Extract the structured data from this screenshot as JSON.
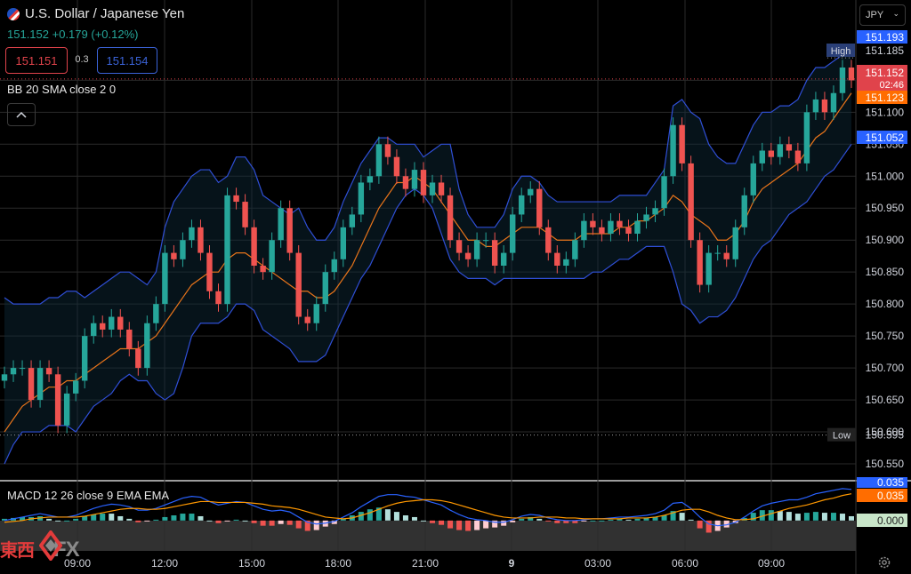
{
  "header": {
    "title": "U.S. Dollar / Japanese Yen",
    "price": "151.152",
    "change": "+0.179 (+0.12%)",
    "sell": "151.151",
    "spread": "0.3",
    "buy": "151.154",
    "currency": "JPY",
    "bb_label": "BB 20 SMA close 2 0",
    "macd_label": "MACD 12 26 close 9 EMA EMA"
  },
  "logo": {
    "text": "東西",
    "fx": "FX"
  },
  "colors": {
    "up": "#26a69a",
    "down": "#ef5350",
    "bb": "#2f4fd6",
    "basis": "#e8741a",
    "macd": "#2962ff",
    "signal": "#ff9800",
    "high_tag": "#2a3f77",
    "price_tag": "#e0434b"
  },
  "chart_data": [
    {
      "type": "candlestick",
      "title": "U.S. Dollar / Japanese Yen",
      "indicator": "BB 20 SMA close 2 0",
      "x_ticks": [
        "09:00",
        "12:00",
        "15:00",
        "18:00",
        "21:00",
        "9",
        "03:00",
        "06:00",
        "09:00"
      ],
      "y_ticks": [
        151.15,
        151.1,
        151.05,
        151.0,
        150.95,
        150.9,
        150.85,
        150.8,
        150.75,
        150.7,
        150.65,
        150.6,
        150.55
      ],
      "ylim": [
        150.525,
        151.22
      ],
      "grid": true,
      "series": [
        {
          "name": "close",
          "values": [
            150.69,
            150.7,
            150.7,
            150.65,
            150.7,
            150.69,
            150.61,
            150.66,
            150.68,
            150.75,
            150.77,
            150.76,
            150.78,
            150.76,
            150.73,
            150.7,
            150.77,
            150.8,
            150.88,
            150.87,
            150.9,
            150.92,
            150.88,
            150.82,
            150.8,
            150.97,
            150.96,
            150.92,
            150.86,
            150.85,
            150.9,
            150.95,
            150.88,
            150.78,
            150.77,
            150.8,
            150.85,
            150.87,
            150.92,
            150.94,
            150.99,
            151.0,
            151.05,
            151.03,
            151.0,
            150.98,
            151.01,
            150.97,
            150.99,
            150.97,
            150.9,
            150.88,
            150.87,
            150.9,
            150.9,
            150.86,
            150.88,
            150.94,
            150.97,
            150.98,
            150.92,
            150.88,
            150.86,
            150.87,
            150.9,
            150.93,
            150.92,
            150.91,
            150.93,
            150.92,
            150.91,
            150.93,
            150.94,
            150.95,
            151.0,
            151.08,
            151.02,
            150.9,
            150.83,
            150.88,
            150.88,
            150.87,
            150.92,
            150.97,
            151.02,
            151.04,
            151.03,
            151.05,
            151.04,
            151.02,
            151.1,
            151.12,
            151.1,
            151.13,
            151.17,
            151.15
          ]
        },
        {
          "name": "BB upper",
          "values": [
            150.81,
            150.8,
            150.8,
            150.8,
            150.8,
            150.81,
            150.81,
            150.82,
            150.82,
            150.81,
            150.82,
            150.83,
            150.84,
            150.85,
            150.85,
            150.84,
            150.83,
            150.85,
            150.92,
            150.96,
            150.98,
            151.0,
            151.01,
            151.01,
            150.99,
            151.0,
            151.03,
            151.03,
            151.01,
            150.97,
            150.96,
            150.95,
            150.94,
            150.95,
            150.92,
            150.9,
            150.9,
            150.92,
            150.96,
            150.99,
            151.02,
            151.04,
            151.06,
            151.06,
            151.05,
            151.05,
            151.05,
            151.03,
            151.04,
            151.05,
            151.05,
            150.98,
            150.94,
            150.92,
            150.92,
            150.92,
            150.94,
            150.98,
            151.0,
            151.0,
            150.99,
            150.97,
            150.96,
            150.96,
            150.96,
            150.96,
            150.96,
            150.96,
            150.96,
            150.97,
            150.97,
            150.97,
            150.97,
            150.99,
            151.01,
            151.11,
            151.12,
            151.1,
            151.09,
            151.05,
            151.03,
            151.02,
            151.02,
            151.05,
            151.08,
            151.1,
            151.1,
            151.11,
            151.11,
            151.12,
            151.15,
            151.17,
            151.17,
            151.18,
            151.19,
            151.2
          ]
        },
        {
          "name": "BB basis",
          "values": [
            150.6,
            150.62,
            150.64,
            150.65,
            150.66,
            150.67,
            150.67,
            150.68,
            150.68,
            150.69,
            150.7,
            150.71,
            150.72,
            150.73,
            150.73,
            150.73,
            150.74,
            150.75,
            150.77,
            150.79,
            150.81,
            150.83,
            150.84,
            150.85,
            150.85,
            150.87,
            150.88,
            150.88,
            150.87,
            150.86,
            150.85,
            150.84,
            150.83,
            150.82,
            150.82,
            150.81,
            150.81,
            150.82,
            150.84,
            150.86,
            150.89,
            150.92,
            150.95,
            150.97,
            150.99,
            150.99,
            151.0,
            150.99,
            150.98,
            150.96,
            150.94,
            150.92,
            150.9,
            150.9,
            150.89,
            150.89,
            150.9,
            150.91,
            150.92,
            150.92,
            150.92,
            150.91,
            150.9,
            150.9,
            150.9,
            150.91,
            150.91,
            150.91,
            150.91,
            150.92,
            150.92,
            150.93,
            150.93,
            150.94,
            150.95,
            150.97,
            150.96,
            150.94,
            150.93,
            150.92,
            150.9,
            150.9,
            150.91,
            150.93,
            150.96,
            150.98,
            150.99,
            151.0,
            151.01,
            151.02,
            151.04,
            151.06,
            151.07,
            151.09,
            151.11,
            151.13
          ]
        },
        {
          "name": "BB lower",
          "values": [
            150.55,
            150.58,
            150.6,
            150.6,
            150.6,
            150.61,
            150.61,
            150.61,
            150.6,
            150.62,
            150.64,
            150.65,
            150.66,
            150.68,
            150.69,
            150.68,
            150.68,
            150.66,
            150.65,
            150.66,
            150.7,
            150.75,
            150.77,
            150.77,
            150.77,
            150.78,
            150.8,
            150.8,
            150.79,
            150.76,
            150.75,
            150.74,
            150.73,
            150.71,
            150.71,
            150.71,
            150.72,
            150.75,
            150.78,
            150.81,
            150.84,
            150.86,
            150.89,
            150.92,
            150.95,
            150.97,
            150.98,
            150.97,
            150.95,
            150.91,
            150.87,
            150.85,
            150.84,
            150.84,
            150.84,
            150.83,
            150.84,
            150.84,
            150.84,
            150.84,
            150.84,
            150.84,
            150.84,
            150.84,
            150.84,
            150.84,
            150.85,
            150.85,
            150.86,
            150.87,
            150.87,
            150.88,
            150.89,
            150.89,
            150.89,
            150.85,
            150.8,
            150.79,
            150.77,
            150.78,
            150.78,
            150.79,
            150.81,
            150.84,
            150.87,
            150.89,
            150.9,
            150.92,
            150.94,
            150.95,
            150.96,
            150.98,
            151.0,
            151.01,
            151.03,
            151.05
          ]
        }
      ],
      "price_levels": {
        "high": 151.193,
        "price": 151.152,
        "ema": 151.123,
        "lower": 151.052,
        "low": 150.595,
        "high_mark": 151.185
      },
      "labels": {
        "high": "High",
        "low": "Low",
        "countdown": "02:46"
      }
    },
    {
      "type": "bar",
      "title": "MACD 12 26 close 9 EMA EMA",
      "ylim": [
        -0.03,
        0.042
      ],
      "y_labels": [
        "0.035",
        "0.035",
        "0.000"
      ],
      "series": [
        {
          "name": "MACD",
          "values": [
            0.0,
            0.002,
            0.004,
            0.006,
            0.008,
            0.006,
            0.004,
            0.004,
            0.006,
            0.01,
            0.014,
            0.017,
            0.019,
            0.018,
            0.016,
            0.012,
            0.012,
            0.014,
            0.018,
            0.022,
            0.026,
            0.028,
            0.027,
            0.022,
            0.018,
            0.02,
            0.022,
            0.021,
            0.017,
            0.013,
            0.011,
            0.012,
            0.01,
            0.004,
            -0.002,
            -0.004,
            -0.003,
            -0.001,
            0.004,
            0.009,
            0.016,
            0.022,
            0.028,
            0.03,
            0.03,
            0.028,
            0.027,
            0.024,
            0.021,
            0.018,
            0.012,
            0.007,
            0.003,
            0.001,
            0.0,
            -0.002,
            -0.002,
            0.001,
            0.005,
            0.007,
            0.006,
            0.003,
            0.001,
            0.0,
            0.0,
            0.001,
            0.002,
            0.002,
            0.003,
            0.004,
            0.004,
            0.005,
            0.006,
            0.008,
            0.012,
            0.02,
            0.021,
            0.014,
            0.004,
            -0.004,
            -0.006,
            -0.005,
            -0.002,
            0.004,
            0.011,
            0.017,
            0.02,
            0.022,
            0.024,
            0.024,
            0.027,
            0.031,
            0.033,
            0.035,
            0.037,
            0.036
          ]
        },
        {
          "name": "Signal",
          "values": [
            -0.002,
            -0.001,
            0.0,
            0.002,
            0.003,
            0.004,
            0.004,
            0.004,
            0.004,
            0.005,
            0.007,
            0.009,
            0.011,
            0.013,
            0.014,
            0.014,
            0.013,
            0.013,
            0.014,
            0.016,
            0.018,
            0.02,
            0.022,
            0.022,
            0.021,
            0.021,
            0.021,
            0.021,
            0.02,
            0.019,
            0.017,
            0.016,
            0.015,
            0.013,
            0.01,
            0.007,
            0.004,
            0.003,
            0.002,
            0.003,
            0.006,
            0.009,
            0.013,
            0.017,
            0.02,
            0.022,
            0.023,
            0.024,
            0.024,
            0.023,
            0.021,
            0.018,
            0.015,
            0.012,
            0.009,
            0.006,
            0.004,
            0.003,
            0.003,
            0.003,
            0.004,
            0.004,
            0.004,
            0.003,
            0.003,
            0.002,
            0.002,
            0.002,
            0.002,
            0.002,
            0.003,
            0.003,
            0.003,
            0.004,
            0.006,
            0.009,
            0.012,
            0.013,
            0.013,
            0.01,
            0.006,
            0.003,
            0.001,
            0.001,
            0.002,
            0.005,
            0.008,
            0.011,
            0.014,
            0.016,
            0.018,
            0.021,
            0.024,
            0.026,
            0.029,
            0.031
          ]
        }
      ]
    }
  ]
}
